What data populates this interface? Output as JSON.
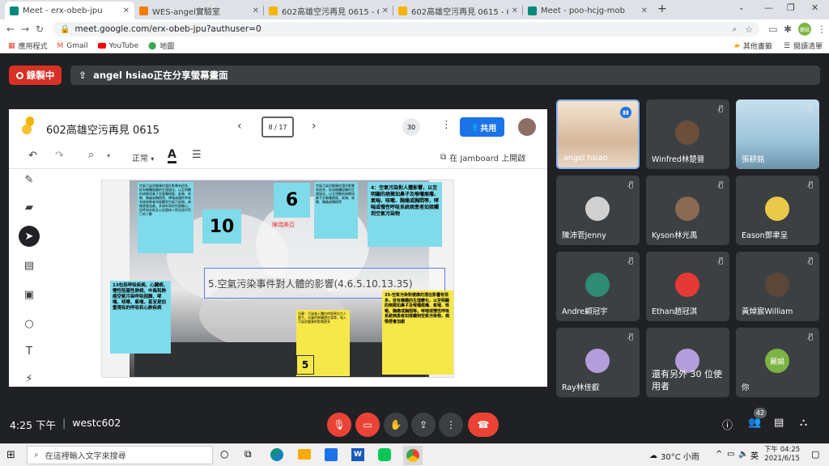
{
  "browser": {
    "tabs": [
      {
        "label": "Meet - erx-obeb-jpu",
        "icon": "meet-icon",
        "active": true
      },
      {
        "label": "WES-angel實驗室",
        "icon": "blogger-icon",
        "active": false
      },
      {
        "label": "602高雄空污再見 0615 - Googl",
        "icon": "jamboard-icon",
        "active": false
      },
      {
        "label": "602高雄空污再見 0615 - Googl",
        "icon": "jamboard-icon",
        "active": false
      },
      {
        "label": "Meet - poo-hcjg-mob",
        "icon": "meet-icon",
        "active": false
      }
    ],
    "url": "meet.google.com/erx-obeb-jpu?authuser=0",
    "bookmarks": [
      "應用程式",
      "Gmail",
      "YouTube",
      "地圖"
    ],
    "bookmarks_right": [
      "其他書籤",
      "閱讀清單"
    ],
    "profile_initials": "麗娟"
  },
  "meet": {
    "recording_label": "錄製中",
    "share_notice": "angel hsiao正在分享螢幕畫面",
    "time": "4:25 下午",
    "meeting_code": "westc602",
    "people_count": "42",
    "colors": {
      "red": "#ea4335",
      "bg": "#202124",
      "tile": "#3c4043",
      "accent": "#8ab4f8"
    }
  },
  "jamboard": {
    "title": "602高雄空污再見 0615",
    "frame_indicator": "8 / 17",
    "zoom_badge": "30",
    "share_button": "共用",
    "font_select": "正常",
    "open_in_jamboard": "在 Jamboard 上開啟",
    "board": {
      "main_title": "5.空氣污染事件對人體的影響(4.6.5.10.13.35)",
      "red_text": "陳瑞美亞",
      "number_notes": [
        "6",
        "10",
        "5"
      ],
      "note_4": "4：空氣污染對人體影響，以至明顯的病徵如鼻子及喉嚨痕癢、氣喘、咳嗽、胸痛或胸悶等，哮喘或慢性呼吸系統病患者如接觸到空氣污染物",
      "note_13": "13包括呼吸疾病、心臟病、慢性阻塞性肺病、中風和肺癌空氣污染呼吸困難、哮喘、咳嗽、氣喘，甚至是加重現有的呼吸和心肺疾病",
      "note_35": "35-空氣污染對健康的潛在影響有很多。從有機體的生理變化，以至明顯的病徵如鼻子及喉嚨痕癢、氣喘、咳嗽、胸痛或胸悶等。哮喘或慢性呼吸系統病患者如接觸到空氣污染物，病情便會加劇",
      "note_left_top": "空氣污染對健康的潛在影響有很多，從有機體組織的生理變化，以至明顯的病徵如鼻子及喉嚨痕癢、氣喘、咳嗽、胸痛或胸悶等，哮喘或慢性呼吸系統病患者如接觸到空氣污染物，病情便會加劇。多項本地研究都顯示，因呼吸系統及心血管病人院及過早死亡的人數",
      "note_mid_top": "空氣污染對健康的潛在影響有很多，從有機體組織的生理變化，以至明顯的病徵如鼻子及喉嚨痕癢、氣喘、咳嗽、胸痛或胸悶等",
      "note_bottom_mid": "兒童：污染進入體內的傷害比大人更大，兒童的肺臟還在發育，吸入污染對健康的影響更多"
    }
  },
  "participants": [
    {
      "name": "angel hsiao",
      "speaking": true,
      "color": "#c9a98c"
    },
    {
      "name": "Winfred林楚晉",
      "muted": true,
      "color": "#6b4f3a"
    },
    {
      "name": "張耕銘",
      "muted": true,
      "color": "#8fb4c8"
    },
    {
      "name": "陳沛菅Jenny",
      "muted": true,
      "color": "#d0d0d0"
    },
    {
      "name": "Kyson林光禹",
      "muted": true,
      "color": "#8b6a54"
    },
    {
      "name": "Eason鄧聿呈",
      "muted": true,
      "color": "#e8c94a"
    },
    {
      "name": "Andre顧冠宇",
      "muted": true,
      "color": "#2e8b74"
    },
    {
      "name": "Ethan趙冠淇",
      "muted": true,
      "color": "#e53935"
    },
    {
      "name": "黃焯宸William",
      "muted": true,
      "color": "#5c4638"
    },
    {
      "name": "Ray林佳叡",
      "muted": true,
      "color": "#b39ddb"
    },
    {
      "name": "還有另外 30 位使用者",
      "muted": false,
      "color": "#b39ddb"
    },
    {
      "name": "你",
      "muted": true,
      "avatar_text": "麗娟",
      "color": "#7cb342"
    }
  ],
  "taskbar": {
    "search_placeholder": "在這裡輸入文字來搜尋",
    "weather": "30°C 小雨",
    "ime": "英",
    "clock_time": "下午 04:25",
    "clock_date": "2021/6/15"
  }
}
